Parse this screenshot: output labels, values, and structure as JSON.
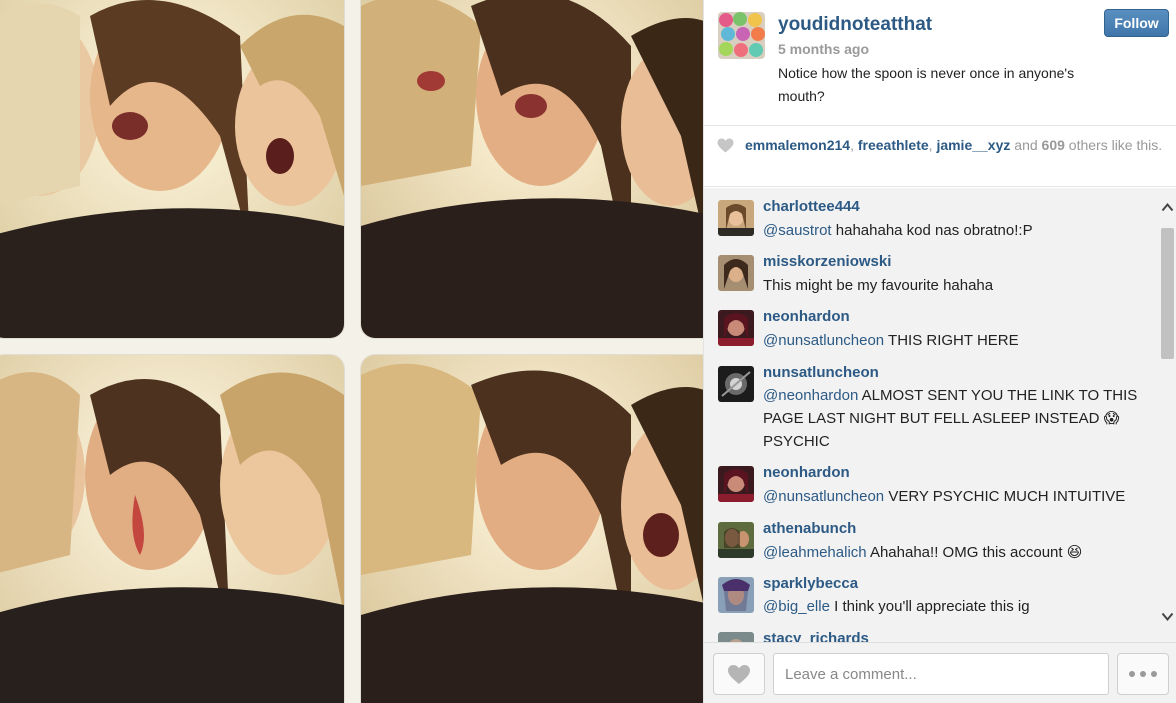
{
  "post": {
    "username": "youdidnoteatthat",
    "follow_label": "Follow",
    "time": "5 months ago",
    "caption": "Notice how the spoon is never once in anyone's mouth?"
  },
  "likes": {
    "users": [
      "emmalemon214",
      "freeathlete",
      "jamie__xyz"
    ],
    "sep1": ", ",
    "sep2": ", ",
    "and_text": " and ",
    "count": "609",
    "suffix": " others like this."
  },
  "comments": [
    {
      "user": "charlottee444",
      "mention": "@saustrot",
      "text": " hahahaha kod nas obratno!:P"
    },
    {
      "user": "misskorzeniowski",
      "mention": "",
      "text": "This might be my favourite hahaha"
    },
    {
      "user": "neonhardon",
      "mention": "@nunsatluncheon",
      "text": " THIS RIGHT HERE"
    },
    {
      "user": "nunsatluncheon",
      "mention": "@neonhardon",
      "text": " ALMOST SENT YOU THE LINK TO THIS PAGE LAST NIGHT BUT FELL ASLEEP INSTEAD 😱 PSYCHIC"
    },
    {
      "user": "neonhardon",
      "mention": "@nunsatluncheon",
      "text": " VERY PSYCHIC MUCH INTUITIVE"
    },
    {
      "user": "athenabunch",
      "mention": "@leahmehalich",
      "text": " Ahahaha!! OMG this account 😆"
    },
    {
      "user": "sparklybecca",
      "mention": "@big_elle",
      "text": " I think you'll appreciate this ig"
    },
    {
      "user": "stacy_richards",
      "mention": "",
      "text": ""
    }
  ],
  "comment_box": {
    "placeholder": "Leave a comment..."
  },
  "icons": {
    "likes": "heart-icon",
    "like_button": "heart-icon",
    "more": "more-dots-icon",
    "scroll_up": "chevron-up-icon",
    "scroll_down": "chevron-down-icon"
  },
  "colors": {
    "link": "#2c5a85",
    "follow_button": "#3f76aa",
    "comment_bg": "#f2f2f2"
  }
}
